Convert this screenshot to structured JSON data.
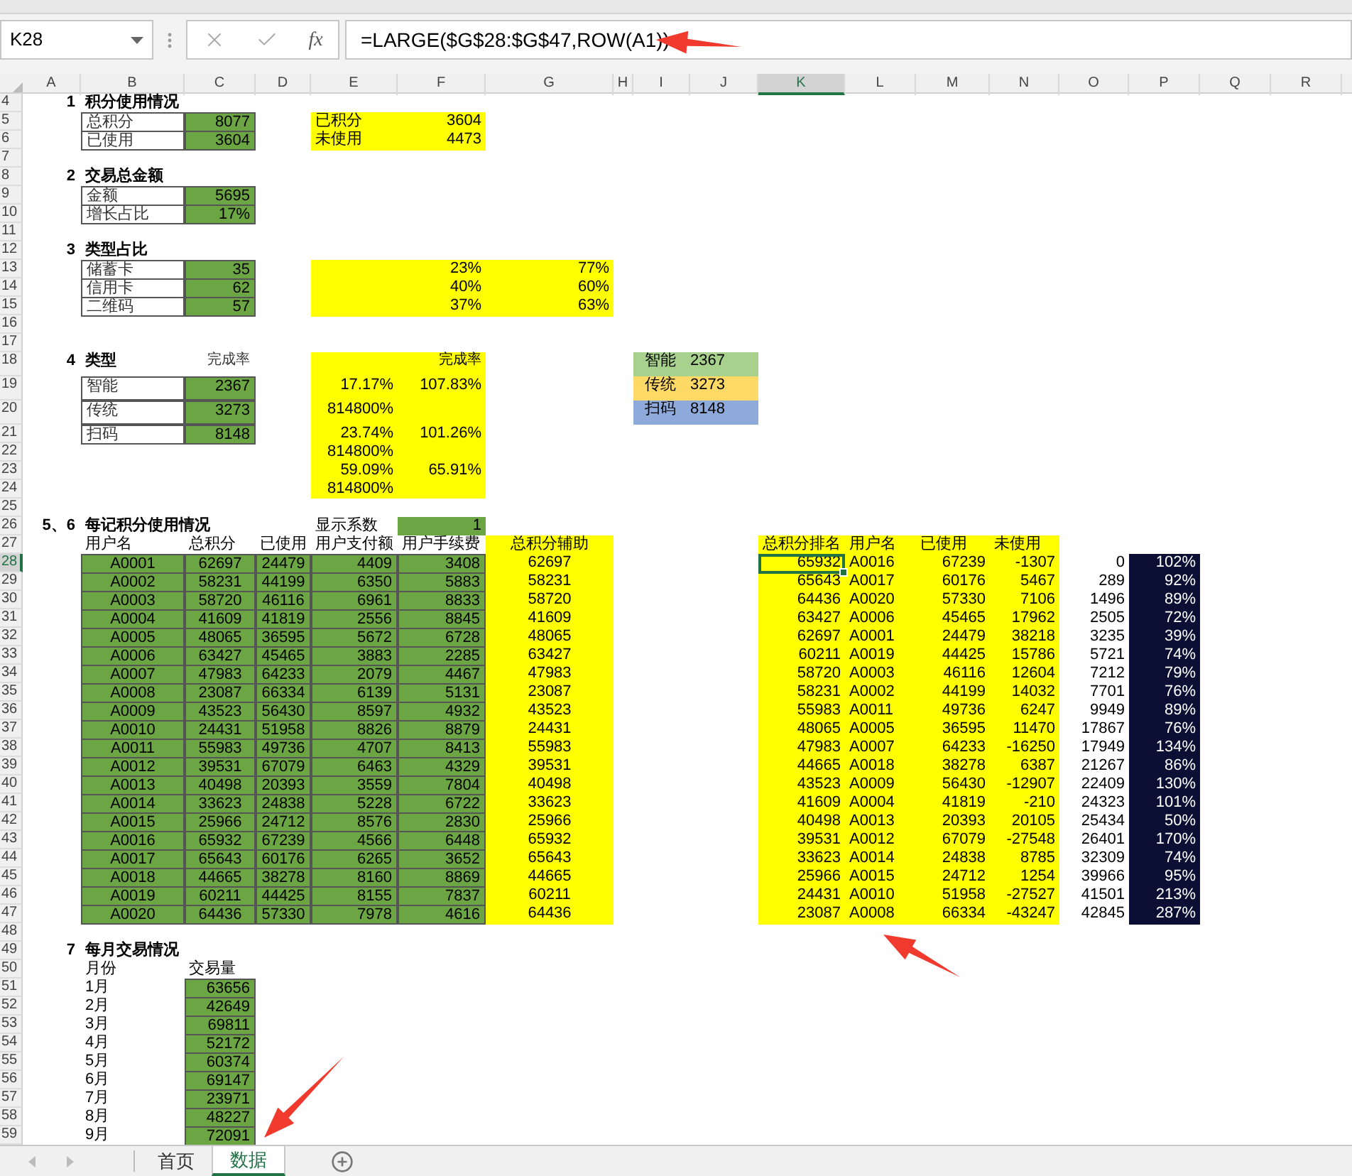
{
  "formula_bar": {
    "name_box": "K28",
    "function_label": "fx",
    "formula": "=LARGE($G$28:$G$47,ROW(A1))"
  },
  "columns": [
    {
      "label": "A",
      "selected": false
    },
    {
      "label": "B",
      "selected": false
    },
    {
      "label": "C",
      "selected": false
    },
    {
      "label": "D",
      "selected": false
    },
    {
      "label": "E",
      "selected": false
    },
    {
      "label": "F",
      "selected": false
    },
    {
      "label": "G",
      "selected": false
    },
    {
      "label": "H",
      "selected": false
    },
    {
      "label": "I",
      "selected": false
    },
    {
      "label": "J",
      "selected": false
    },
    {
      "label": "K",
      "selected": true
    },
    {
      "label": "L",
      "selected": false
    },
    {
      "label": "M",
      "selected": false
    },
    {
      "label": "N",
      "selected": false
    },
    {
      "label": "O",
      "selected": false
    },
    {
      "label": "P",
      "selected": false
    },
    {
      "label": "Q",
      "selected": false
    },
    {
      "label": "R",
      "selected": false
    }
  ],
  "rows": [
    {
      "number": "4",
      "selected": false,
      "cells": {
        "A": {
          "kind": "number",
          "text": "1"
        },
        "B": {
          "kind": "title",
          "text": "积分使用情况"
        }
      }
    },
    {
      "number": "5",
      "selected": false,
      "cells": {
        "B": {
          "kind": "boxed",
          "text": "总积分"
        },
        "C": {
          "kind": "green",
          "text": "8077"
        },
        "E": {
          "kind": "yellow-left",
          "text": "已积分"
        },
        "F": {
          "kind": "yellow",
          "text": "3604"
        }
      }
    },
    {
      "number": "6",
      "selected": false,
      "cells": {
        "B": {
          "kind": "boxed",
          "text": "已使用"
        },
        "C": {
          "kind": "green",
          "text": "3604"
        },
        "E": {
          "kind": "yellow-left",
          "text": "未使用"
        },
        "F": {
          "kind": "yellow",
          "text": "4473"
        }
      }
    },
    {
      "number": "7",
      "selected": false,
      "cells": {}
    },
    {
      "number": "8",
      "selected": false,
      "cells": {
        "A": {
          "kind": "number",
          "text": "2"
        },
        "B": {
          "kind": "title",
          "text": "交易总金额"
        }
      }
    },
    {
      "number": "9",
      "selected": false,
      "cells": {
        "B": {
          "kind": "boxed",
          "text": "金额"
        },
        "C": {
          "kind": "green",
          "text": "5695"
        }
      }
    },
    {
      "number": "10",
      "selected": false,
      "cells": {
        "B": {
          "kind": "boxed",
          "text": "增长占比"
        },
        "C": {
          "kind": "green",
          "text": "17%"
        }
      }
    },
    {
      "number": "11",
      "selected": false,
      "cells": {}
    },
    {
      "number": "12",
      "selected": false,
      "cells": {
        "A": {
          "kind": "number",
          "text": "3"
        },
        "B": {
          "kind": "title",
          "text": "类型占比"
        }
      }
    },
    {
      "number": "13",
      "selected": false,
      "cells": {
        "B": {
          "kind": "boxed",
          "text": "储蓄卡"
        },
        "C": {
          "kind": "green",
          "text": "35"
        },
        "E": {
          "kind": "yellow"
        },
        "F": {
          "kind": "yellow",
          "text": "23%"
        },
        "G": {
          "kind": "yellow",
          "text": "77%"
        }
      }
    },
    {
      "number": "14",
      "selected": false,
      "cells": {
        "B": {
          "kind": "boxed",
          "text": "信用卡"
        },
        "C": {
          "kind": "green",
          "text": "62"
        },
        "E": {
          "kind": "yellow"
        },
        "F": {
          "kind": "yellow",
          "text": "40%"
        },
        "G": {
          "kind": "yellow",
          "text": "60%"
        }
      }
    },
    {
      "number": "15",
      "selected": false,
      "cells": {
        "B": {
          "kind": "boxed",
          "text": "二维码"
        },
        "C": {
          "kind": "green",
          "text": "57"
        },
        "E": {
          "kind": "yellow"
        },
        "F": {
          "kind": "yellow",
          "text": "37%"
        },
        "G": {
          "kind": "yellow",
          "text": "63%"
        }
      }
    },
    {
      "number": "16",
      "selected": false,
      "cells": {}
    },
    {
      "number": "17",
      "selected": false,
      "cells": {}
    },
    {
      "number": "18",
      "selected": false,
      "cells": {
        "A": {
          "kind": "number",
          "text": "4"
        },
        "B": {
          "kind": "title",
          "text": "类型"
        },
        "C": {
          "kind": "note",
          "text": "完成率"
        },
        "E": {
          "kind": "yellow"
        },
        "F": {
          "kind": "yellow-note",
          "text": "完成率"
        },
        "I": {
          "kind": "legend",
          "text": "智能",
          "color": "#a9d18e"
        },
        "J": {
          "kind": "legend-value",
          "text": "2367",
          "color": "#a9d18e"
        }
      }
    },
    {
      "number": "19",
      "selected": false,
      "cells": {
        "B": {
          "kind": "boxed",
          "text": "智能"
        },
        "C": {
          "kind": "green",
          "text": "2367"
        },
        "E": {
          "kind": "yellow",
          "text": "17.17%"
        },
        "F": {
          "kind": "yellow",
          "text": "107.83%"
        },
        "I": {
          "kind": "legend",
          "text": "传统",
          "color": "#ffd966"
        },
        "J": {
          "kind": "legend-value",
          "text": "3273",
          "color": "#ffd966"
        }
      }
    },
    {
      "number": "20",
      "selected": false,
      "cells": {
        "B": {
          "kind": "boxed",
          "text": "传统"
        },
        "C": {
          "kind": "green",
          "text": "3273"
        },
        "E": {
          "kind": "yellow",
          "text": "814800%"
        },
        "F": {
          "kind": "yellow"
        },
        "I": {
          "kind": "legend",
          "text": "扫码",
          "color": "#8eaadb"
        },
        "J": {
          "kind": "legend-value",
          "text": "8148",
          "color": "#8eaadb"
        }
      }
    },
    {
      "number": "21",
      "selected": false,
      "cells": {
        "B": {
          "kind": "boxed",
          "text": "扫码"
        },
        "C": {
          "kind": "green",
          "text": "8148"
        },
        "E": {
          "kind": "yellow",
          "text": "23.74%"
        },
        "F": {
          "kind": "yellow",
          "text": "101.26%"
        }
      }
    },
    {
      "number": "22",
      "selected": false,
      "cells": {
        "E": {
          "kind": "yellow",
          "text": "814800%"
        },
        "F": {
          "kind": "yellow"
        }
      }
    },
    {
      "number": "23",
      "selected": false,
      "cells": {
        "E": {
          "kind": "yellow",
          "text": "59.09%"
        },
        "F": {
          "kind": "yellow",
          "text": "65.91%"
        }
      }
    },
    {
      "number": "24",
      "selected": false,
      "cells": {
        "E": {
          "kind": "yellow",
          "text": "814800%"
        },
        "F": {
          "kind": "yellow"
        }
      }
    },
    {
      "number": "25",
      "selected": false,
      "cells": {}
    },
    {
      "number": "26",
      "selected": false,
      "cells": {
        "A": {
          "kind": "number",
          "text": "5、6"
        },
        "B": {
          "kind": "title",
          "text": "每记积分使用情况"
        },
        "E": {
          "kind": "label",
          "text": "显示系数"
        },
        "F": {
          "kind": "green-plain",
          "text": "1"
        }
      }
    },
    {
      "number": "27",
      "selected": false,
      "cells": {
        "B": {
          "kind": "label",
          "text": "用户名"
        },
        "C": {
          "kind": "label",
          "text": "总积分"
        },
        "D": {
          "kind": "label",
          "text": "已使用"
        },
        "E": {
          "kind": "label",
          "text": "用户支付额"
        },
        "F": {
          "kind": "label",
          "text": "用户手续费"
        },
        "G": {
          "kind": "yellow-center",
          "text": "总积分辅助"
        },
        "K": {
          "kind": "yellow-left",
          "text": "总积分排名"
        },
        "L": {
          "kind": "yellow-left",
          "text": "用户名"
        },
        "M": {
          "kind": "yellow-left",
          "text": "已使用"
        },
        "N": {
          "kind": "yellow-left",
          "text": "未使用"
        }
      }
    },
    {
      "number": "28",
      "selected": true,
      "cells": {
        "B": {
          "kind": "green-center",
          "text": "A0001"
        },
        "C": {
          "kind": "green-center",
          "text": "62697"
        },
        "D": {
          "kind": "green-center",
          "text": "24479"
        },
        "E": {
          "kind": "green",
          "text": "4409"
        },
        "F": {
          "kind": "green",
          "text": "3408"
        },
        "G": {
          "kind": "yellow-center",
          "text": "62697"
        },
        "K": {
          "kind": "yellow",
          "text": "65932"
        },
        "L": {
          "kind": "yellow-left",
          "text": "A0016"
        },
        "M": {
          "kind": "yellow",
          "text": "67239"
        },
        "N": {
          "kind": "yellow",
          "text": "-1307"
        },
        "O": {
          "kind": "value",
          "text": "0"
        },
        "P": {
          "kind": "dark",
          "text": "102%"
        }
      }
    },
    {
      "number": "29",
      "selected": false,
      "cells": {
        "B": {
          "kind": "green-center",
          "text": "A0002"
        },
        "C": {
          "kind": "green-center",
          "text": "58231"
        },
        "D": {
          "kind": "green-center",
          "text": "44199"
        },
        "E": {
          "kind": "green",
          "text": "6350"
        },
        "F": {
          "kind": "green",
          "text": "5883"
        },
        "G": {
          "kind": "yellow-center",
          "text": "58231"
        },
        "K": {
          "kind": "yellow",
          "text": "65643"
        },
        "L": {
          "kind": "yellow-left",
          "text": "A0017"
        },
        "M": {
          "kind": "yellow",
          "text": "60176"
        },
        "N": {
          "kind": "yellow",
          "text": "5467"
        },
        "O": {
          "kind": "value",
          "text": "289"
        },
        "P": {
          "kind": "dark",
          "text": "92%"
        }
      }
    },
    {
      "number": "30",
      "selected": false,
      "cells": {
        "B": {
          "kind": "green-center",
          "text": "A0003"
        },
        "C": {
          "kind": "green-center",
          "text": "58720"
        },
        "D": {
          "kind": "green-center",
          "text": "46116"
        },
        "E": {
          "kind": "green",
          "text": "6961"
        },
        "F": {
          "kind": "green",
          "text": "8833"
        },
        "G": {
          "kind": "yellow-center",
          "text": "58720"
        },
        "K": {
          "kind": "yellow",
          "text": "64436"
        },
        "L": {
          "kind": "yellow-left",
          "text": "A0020"
        },
        "M": {
          "kind": "yellow",
          "text": "57330"
        },
        "N": {
          "kind": "yellow",
          "text": "7106"
        },
        "O": {
          "kind": "value",
          "text": "1496"
        },
        "P": {
          "kind": "dark",
          "text": "89%"
        }
      }
    },
    {
      "number": "31",
      "selected": false,
      "cells": {
        "B": {
          "kind": "green-center",
          "text": "A0004"
        },
        "C": {
          "kind": "green-center",
          "text": "41609"
        },
        "D": {
          "kind": "green-center",
          "text": "41819"
        },
        "E": {
          "kind": "green",
          "text": "2556"
        },
        "F": {
          "kind": "green",
          "text": "8845"
        },
        "G": {
          "kind": "yellow-center",
          "text": "41609"
        },
        "K": {
          "kind": "yellow",
          "text": "63427"
        },
        "L": {
          "kind": "yellow-left",
          "text": "A0006"
        },
        "M": {
          "kind": "yellow",
          "text": "45465"
        },
        "N": {
          "kind": "yellow",
          "text": "17962"
        },
        "O": {
          "kind": "value",
          "text": "2505"
        },
        "P": {
          "kind": "dark",
          "text": "72%"
        }
      }
    },
    {
      "number": "32",
      "selected": false,
      "cells": {
        "B": {
          "kind": "green-center",
          "text": "A0005"
        },
        "C": {
          "kind": "green-center",
          "text": "48065"
        },
        "D": {
          "kind": "green-center",
          "text": "36595"
        },
        "E": {
          "kind": "green",
          "text": "5672"
        },
        "F": {
          "kind": "green",
          "text": "6728"
        },
        "G": {
          "kind": "yellow-center",
          "text": "48065"
        },
        "K": {
          "kind": "yellow",
          "text": "62697"
        },
        "L": {
          "kind": "yellow-left",
          "text": "A0001"
        },
        "M": {
          "kind": "yellow",
          "text": "24479"
        },
        "N": {
          "kind": "yellow",
          "text": "38218"
        },
        "O": {
          "kind": "value",
          "text": "3235"
        },
        "P": {
          "kind": "dark",
          "text": "39%"
        }
      }
    },
    {
      "number": "33",
      "selected": false,
      "cells": {
        "B": {
          "kind": "green-center",
          "text": "A0006"
        },
        "C": {
          "kind": "green-center",
          "text": "63427"
        },
        "D": {
          "kind": "green-center",
          "text": "45465"
        },
        "E": {
          "kind": "green",
          "text": "3883"
        },
        "F": {
          "kind": "green",
          "text": "2285"
        },
        "G": {
          "kind": "yellow-center",
          "text": "63427"
        },
        "K": {
          "kind": "yellow",
          "text": "60211"
        },
        "L": {
          "kind": "yellow-left",
          "text": "A0019"
        },
        "M": {
          "kind": "yellow",
          "text": "44425"
        },
        "N": {
          "kind": "yellow",
          "text": "15786"
        },
        "O": {
          "kind": "value",
          "text": "5721"
        },
        "P": {
          "kind": "dark",
          "text": "74%"
        }
      }
    },
    {
      "number": "34",
      "selected": false,
      "cells": {
        "B": {
          "kind": "green-center",
          "text": "A0007"
        },
        "C": {
          "kind": "green-center",
          "text": "47983"
        },
        "D": {
          "kind": "green-center",
          "text": "64233"
        },
        "E": {
          "kind": "green",
          "text": "2079"
        },
        "F": {
          "kind": "green",
          "text": "4467"
        },
        "G": {
          "kind": "yellow-center",
          "text": "47983"
        },
        "K": {
          "kind": "yellow",
          "text": "58720"
        },
        "L": {
          "kind": "yellow-left",
          "text": "A0003"
        },
        "M": {
          "kind": "yellow",
          "text": "46116"
        },
        "N": {
          "kind": "yellow",
          "text": "12604"
        },
        "O": {
          "kind": "value",
          "text": "7212"
        },
        "P": {
          "kind": "dark",
          "text": "79%"
        }
      }
    },
    {
      "number": "35",
      "selected": false,
      "cells": {
        "B": {
          "kind": "green-center",
          "text": "A0008"
        },
        "C": {
          "kind": "green-center",
          "text": "23087"
        },
        "D": {
          "kind": "green-center",
          "text": "66334"
        },
        "E": {
          "kind": "green",
          "text": "6139"
        },
        "F": {
          "kind": "green",
          "text": "5131"
        },
        "G": {
          "kind": "yellow-center",
          "text": "23087"
        },
        "K": {
          "kind": "yellow",
          "text": "58231"
        },
        "L": {
          "kind": "yellow-left",
          "text": "A0002"
        },
        "M": {
          "kind": "yellow",
          "text": "44199"
        },
        "N": {
          "kind": "yellow",
          "text": "14032"
        },
        "O": {
          "kind": "value",
          "text": "7701"
        },
        "P": {
          "kind": "dark",
          "text": "76%"
        }
      }
    },
    {
      "number": "36",
      "selected": false,
      "cells": {
        "B": {
          "kind": "green-center",
          "text": "A0009"
        },
        "C": {
          "kind": "green-center",
          "text": "43523"
        },
        "D": {
          "kind": "green-center",
          "text": "56430"
        },
        "E": {
          "kind": "green",
          "text": "8597"
        },
        "F": {
          "kind": "green",
          "text": "4932"
        },
        "G": {
          "kind": "yellow-center",
          "text": "43523"
        },
        "K": {
          "kind": "yellow",
          "text": "55983"
        },
        "L": {
          "kind": "yellow-left",
          "text": "A0011"
        },
        "M": {
          "kind": "yellow",
          "text": "49736"
        },
        "N": {
          "kind": "yellow",
          "text": "6247"
        },
        "O": {
          "kind": "value",
          "text": "9949"
        },
        "P": {
          "kind": "dark",
          "text": "89%"
        }
      }
    },
    {
      "number": "37",
      "selected": false,
      "cells": {
        "B": {
          "kind": "green-center",
          "text": "A0010"
        },
        "C": {
          "kind": "green-center",
          "text": "24431"
        },
        "D": {
          "kind": "green-center",
          "text": "51958"
        },
        "E": {
          "kind": "green",
          "text": "8826"
        },
        "F": {
          "kind": "green",
          "text": "8879"
        },
        "G": {
          "kind": "yellow-center",
          "text": "24431"
        },
        "K": {
          "kind": "yellow",
          "text": "48065"
        },
        "L": {
          "kind": "yellow-left",
          "text": "A0005"
        },
        "M": {
          "kind": "yellow",
          "text": "36595"
        },
        "N": {
          "kind": "yellow",
          "text": "11470"
        },
        "O": {
          "kind": "value",
          "text": "17867"
        },
        "P": {
          "kind": "dark",
          "text": "76%"
        }
      }
    },
    {
      "number": "38",
      "selected": false,
      "cells": {
        "B": {
          "kind": "green-center",
          "text": "A0011"
        },
        "C": {
          "kind": "green-center",
          "text": "55983"
        },
        "D": {
          "kind": "green-center",
          "text": "49736"
        },
        "E": {
          "kind": "green",
          "text": "4707"
        },
        "F": {
          "kind": "green",
          "text": "8413"
        },
        "G": {
          "kind": "yellow-center",
          "text": "55983"
        },
        "K": {
          "kind": "yellow",
          "text": "47983"
        },
        "L": {
          "kind": "yellow-left",
          "text": "A0007"
        },
        "M": {
          "kind": "yellow",
          "text": "64233"
        },
        "N": {
          "kind": "yellow",
          "text": "-16250"
        },
        "O": {
          "kind": "value",
          "text": "17949"
        },
        "P": {
          "kind": "dark",
          "text": "134%"
        }
      }
    },
    {
      "number": "39",
      "selected": false,
      "cells": {
        "B": {
          "kind": "green-center",
          "text": "A0012"
        },
        "C": {
          "kind": "green-center",
          "text": "39531"
        },
        "D": {
          "kind": "green-center",
          "text": "67079"
        },
        "E": {
          "kind": "green",
          "text": "6463"
        },
        "F": {
          "kind": "green",
          "text": "4329"
        },
        "G": {
          "kind": "yellow-center",
          "text": "39531"
        },
        "K": {
          "kind": "yellow",
          "text": "44665"
        },
        "L": {
          "kind": "yellow-left",
          "text": "A0018"
        },
        "M": {
          "kind": "yellow",
          "text": "38278"
        },
        "N": {
          "kind": "yellow",
          "text": "6387"
        },
        "O": {
          "kind": "value",
          "text": "21267"
        },
        "P": {
          "kind": "dark",
          "text": "86%"
        }
      }
    },
    {
      "number": "40",
      "selected": false,
      "cells": {
        "B": {
          "kind": "green-center",
          "text": "A0013"
        },
        "C": {
          "kind": "green-center",
          "text": "40498"
        },
        "D": {
          "kind": "green-center",
          "text": "20393"
        },
        "E": {
          "kind": "green",
          "text": "3559"
        },
        "F": {
          "kind": "green",
          "text": "7804"
        },
        "G": {
          "kind": "yellow-center",
          "text": "40498"
        },
        "K": {
          "kind": "yellow",
          "text": "43523"
        },
        "L": {
          "kind": "yellow-left",
          "text": "A0009"
        },
        "M": {
          "kind": "yellow",
          "text": "56430"
        },
        "N": {
          "kind": "yellow",
          "text": "-12907"
        },
        "O": {
          "kind": "value",
          "text": "22409"
        },
        "P": {
          "kind": "dark",
          "text": "130%"
        }
      }
    },
    {
      "number": "41",
      "selected": false,
      "cells": {
        "B": {
          "kind": "green-center",
          "text": "A0014"
        },
        "C": {
          "kind": "green-center",
          "text": "33623"
        },
        "D": {
          "kind": "green-center",
          "text": "24838"
        },
        "E": {
          "kind": "green",
          "text": "5228"
        },
        "F": {
          "kind": "green",
          "text": "6722"
        },
        "G": {
          "kind": "yellow-center",
          "text": "33623"
        },
        "K": {
          "kind": "yellow",
          "text": "41609"
        },
        "L": {
          "kind": "yellow-left",
          "text": "A0004"
        },
        "M": {
          "kind": "yellow",
          "text": "41819"
        },
        "N": {
          "kind": "yellow",
          "text": "-210"
        },
        "O": {
          "kind": "value",
          "text": "24323"
        },
        "P": {
          "kind": "dark",
          "text": "101%"
        }
      }
    },
    {
      "number": "42",
      "selected": false,
      "cells": {
        "B": {
          "kind": "green-center",
          "text": "A0015"
        },
        "C": {
          "kind": "green-center",
          "text": "25966"
        },
        "D": {
          "kind": "green-center",
          "text": "24712"
        },
        "E": {
          "kind": "green",
          "text": "8576"
        },
        "F": {
          "kind": "green",
          "text": "2830"
        },
        "G": {
          "kind": "yellow-center",
          "text": "25966"
        },
        "K": {
          "kind": "yellow",
          "text": "40498"
        },
        "L": {
          "kind": "yellow-left",
          "text": "A0013"
        },
        "M": {
          "kind": "yellow",
          "text": "20393"
        },
        "N": {
          "kind": "yellow",
          "text": "20105"
        },
        "O": {
          "kind": "value",
          "text": "25434"
        },
        "P": {
          "kind": "dark",
          "text": "50%"
        }
      }
    },
    {
      "number": "43",
      "selected": false,
      "cells": {
        "B": {
          "kind": "green-center",
          "text": "A0016"
        },
        "C": {
          "kind": "green-center",
          "text": "65932"
        },
        "D": {
          "kind": "green-center",
          "text": "67239"
        },
        "E": {
          "kind": "green",
          "text": "4566"
        },
        "F": {
          "kind": "green",
          "text": "6448"
        },
        "G": {
          "kind": "yellow-center",
          "text": "65932"
        },
        "K": {
          "kind": "yellow",
          "text": "39531"
        },
        "L": {
          "kind": "yellow-left",
          "text": "A0012"
        },
        "M": {
          "kind": "yellow",
          "text": "67079"
        },
        "N": {
          "kind": "yellow",
          "text": "-27548"
        },
        "O": {
          "kind": "value",
          "text": "26401"
        },
        "P": {
          "kind": "dark",
          "text": "170%"
        }
      }
    },
    {
      "number": "44",
      "selected": false,
      "cells": {
        "B": {
          "kind": "green-center",
          "text": "A0017"
        },
        "C": {
          "kind": "green-center",
          "text": "65643"
        },
        "D": {
          "kind": "green-center",
          "text": "60176"
        },
        "E": {
          "kind": "green",
          "text": "6265"
        },
        "F": {
          "kind": "green",
          "text": "3652"
        },
        "G": {
          "kind": "yellow-center",
          "text": "65643"
        },
        "K": {
          "kind": "yellow",
          "text": "33623"
        },
        "L": {
          "kind": "yellow-left",
          "text": "A0014"
        },
        "M": {
          "kind": "yellow",
          "text": "24838"
        },
        "N": {
          "kind": "yellow",
          "text": "8785"
        },
        "O": {
          "kind": "value",
          "text": "32309"
        },
        "P": {
          "kind": "dark",
          "text": "74%"
        }
      }
    },
    {
      "number": "45",
      "selected": false,
      "cells": {
        "B": {
          "kind": "green-center",
          "text": "A0018"
        },
        "C": {
          "kind": "green-center",
          "text": "44665"
        },
        "D": {
          "kind": "green-center",
          "text": "38278"
        },
        "E": {
          "kind": "green",
          "text": "8160"
        },
        "F": {
          "kind": "green",
          "text": "8869"
        },
        "G": {
          "kind": "yellow-center",
          "text": "44665"
        },
        "K": {
          "kind": "yellow",
          "text": "25966"
        },
        "L": {
          "kind": "yellow-left",
          "text": "A0015"
        },
        "M": {
          "kind": "yellow",
          "text": "24712"
        },
        "N": {
          "kind": "yellow",
          "text": "1254"
        },
        "O": {
          "kind": "value",
          "text": "39966"
        },
        "P": {
          "kind": "dark",
          "text": "95%"
        }
      }
    },
    {
      "number": "46",
      "selected": false,
      "cells": {
        "B": {
          "kind": "green-center",
          "text": "A0019"
        },
        "C": {
          "kind": "green-center",
          "text": "60211"
        },
        "D": {
          "kind": "green-center",
          "text": "44425"
        },
        "E": {
          "kind": "green",
          "text": "8155"
        },
        "F": {
          "kind": "green",
          "text": "7837"
        },
        "G": {
          "kind": "yellow-center",
          "text": "60211"
        },
        "K": {
          "kind": "yellow",
          "text": "24431"
        },
        "L": {
          "kind": "yellow-left",
          "text": "A0010"
        },
        "M": {
          "kind": "yellow",
          "text": "51958"
        },
        "N": {
          "kind": "yellow",
          "text": "-27527"
        },
        "O": {
          "kind": "value",
          "text": "41501"
        },
        "P": {
          "kind": "dark",
          "text": "213%"
        }
      }
    },
    {
      "number": "47",
      "selected": false,
      "cells": {
        "B": {
          "kind": "green-center",
          "text": "A0020"
        },
        "C": {
          "kind": "green-center",
          "text": "64436"
        },
        "D": {
          "kind": "green-center",
          "text": "57330"
        },
        "E": {
          "kind": "green",
          "text": "7978"
        },
        "F": {
          "kind": "green",
          "text": "4616"
        },
        "G": {
          "kind": "yellow-center",
          "text": "64436"
        },
        "K": {
          "kind": "yellow",
          "text": "23087"
        },
        "L": {
          "kind": "yellow-left",
          "text": "A0008"
        },
        "M": {
          "kind": "yellow",
          "text": "66334"
        },
        "N": {
          "kind": "yellow",
          "text": "-43247"
        },
        "O": {
          "kind": "value",
          "text": "42845"
        },
        "P": {
          "kind": "dark",
          "text": "287%"
        }
      }
    },
    {
      "number": "48",
      "selected": false,
      "cells": {}
    },
    {
      "number": "49",
      "selected": false,
      "cells": {
        "A": {
          "kind": "number",
          "text": "7"
        },
        "B": {
          "kind": "title",
          "text": "每月交易情况"
        }
      }
    },
    {
      "number": "50",
      "selected": false,
      "cells": {
        "B": {
          "kind": "label",
          "text": "月份"
        },
        "C": {
          "kind": "label",
          "text": "交易量"
        }
      }
    },
    {
      "number": "51",
      "selected": false,
      "cells": {
        "B": {
          "kind": "label",
          "text": "1月"
        },
        "C": {
          "kind": "green",
          "text": "63656"
        }
      }
    },
    {
      "number": "52",
      "selected": false,
      "cells": {
        "B": {
          "kind": "label",
          "text": "2月"
        },
        "C": {
          "kind": "green",
          "text": "42649"
        }
      }
    },
    {
      "number": "53",
      "selected": false,
      "cells": {
        "B": {
          "kind": "label",
          "text": "3月"
        },
        "C": {
          "kind": "green",
          "text": "69811"
        }
      }
    },
    {
      "number": "54",
      "selected": false,
      "cells": {
        "B": {
          "kind": "label",
          "text": "4月"
        },
        "C": {
          "kind": "green",
          "text": "52172"
        }
      }
    },
    {
      "number": "55",
      "selected": false,
      "cells": {
        "B": {
          "kind": "label",
          "text": "5月"
        },
        "C": {
          "kind": "green",
          "text": "60374"
        }
      }
    },
    {
      "number": "56",
      "selected": false,
      "cells": {
        "B": {
          "kind": "label",
          "text": "6月"
        },
        "C": {
          "kind": "green",
          "text": "69147"
        }
      }
    },
    {
      "number": "57",
      "selected": false,
      "cells": {
        "B": {
          "kind": "label",
          "text": "7月"
        },
        "C": {
          "kind": "green",
          "text": "23971"
        }
      }
    },
    {
      "number": "58",
      "selected": false,
      "cells": {
        "B": {
          "kind": "label",
          "text": "8月"
        },
        "C": {
          "kind": "green",
          "text": "48227"
        }
      }
    },
    {
      "number": "59",
      "selected": false,
      "cells": {
        "B": {
          "kind": "label",
          "text": "9月"
        },
        "C": {
          "kind": "green",
          "text": "72091"
        }
      }
    }
  ],
  "sheet_tabs": [
    {
      "label": "首页",
      "selected": false
    },
    {
      "label": "数据",
      "selected": true
    }
  ]
}
